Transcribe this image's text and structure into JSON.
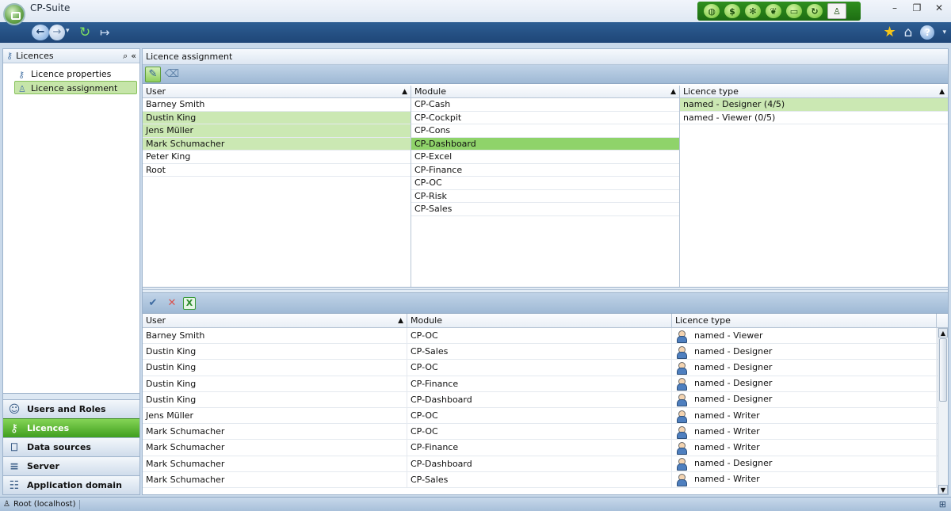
{
  "window": {
    "title": "CP-Suite"
  },
  "module_bar": {
    "icons": [
      "globe-icon",
      "hand-money-icon",
      "bug-icon",
      "leaf-icon",
      "banknote-icon",
      "refresh-circle-icon",
      "admin-icon"
    ]
  },
  "nav": {
    "back_icon": "←",
    "forward_icon": "→",
    "dropdown": "▾",
    "refresh_icon": "↻",
    "exit_icon": "↦",
    "star": "★",
    "home": "⌂",
    "help": "?"
  },
  "left": {
    "header": "Licences",
    "search_icon": "⌕",
    "collapse_icon": "«",
    "tree": [
      {
        "label": "Licence properties"
      },
      {
        "label": "Licence assignment"
      }
    ],
    "groups": [
      {
        "label": "Users and Roles",
        "icon": "☺"
      },
      {
        "label": "Licences",
        "icon": "⚷"
      },
      {
        "label": "Data sources",
        "icon": "⎕"
      },
      {
        "label": "Server",
        "icon": "≡"
      },
      {
        "label": "Application domain",
        "icon": "☷"
      }
    ]
  },
  "right": {
    "header": "Licence assignment",
    "users_list": {
      "header": "User",
      "rows": [
        "Barney Smith",
        "Dustin King",
        "Jens Müller",
        "Mark Schumacher",
        "Peter King",
        "Root"
      ]
    },
    "modules_list": {
      "header": "Module",
      "rows": [
        "CP-Cash",
        "CP-Cockpit",
        "CP-Cons",
        "CP-Dashboard",
        "CP-Excel",
        "CP-Finance",
        "CP-OC",
        "CP-Risk",
        "CP-Sales"
      ]
    },
    "licence_types_list": {
      "header": "Licence type",
      "rows": [
        "named - Designer (4/5)",
        "named - Viewer (0/5)"
      ]
    },
    "grid": {
      "headers": [
        "User",
        "Module",
        "Licence type"
      ],
      "rows": [
        {
          "user": "Barney Smith",
          "module": "CP-OC",
          "licence": "named - Viewer"
        },
        {
          "user": "Dustin King",
          "module": "CP-Sales",
          "licence": "named - Designer"
        },
        {
          "user": "Dustin King",
          "module": "CP-OC",
          "licence": "named - Designer"
        },
        {
          "user": "Dustin King",
          "module": "CP-Finance",
          "licence": "named - Designer"
        },
        {
          "user": "Dustin King",
          "module": "CP-Dashboard",
          "licence": "named - Designer"
        },
        {
          "user": "Jens Müller",
          "module": "CP-OC",
          "licence": "named - Writer"
        },
        {
          "user": "Mark Schumacher",
          "module": "CP-OC",
          "licence": "named - Writer"
        },
        {
          "user": "Mark Schumacher",
          "module": "CP-Finance",
          "licence": "named - Writer"
        },
        {
          "user": "Mark Schumacher",
          "module": "CP-Dashboard",
          "licence": "named - Designer"
        },
        {
          "user": "Mark Schumacher",
          "module": "CP-Sales",
          "licence": "named - Writer"
        }
      ]
    }
  },
  "status": {
    "text": "Root (localhost)"
  },
  "colors": {
    "accent_green": "#8fd36a",
    "highlight_green": "#cbe8b3",
    "nav_blue": "#2d5d93"
  }
}
